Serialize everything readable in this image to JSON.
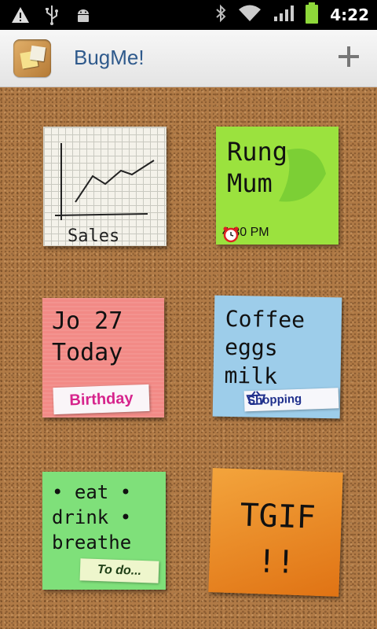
{
  "status_bar": {
    "time": "4:22",
    "icons": [
      "warning-icon",
      "usb-icon",
      "android-debug-icon",
      "bluetooth-icon",
      "wifi-icon",
      "signal-icon",
      "battery-icon"
    ]
  },
  "action_bar": {
    "title": "BugMe!",
    "add_icon": "plus-icon"
  },
  "notes": [
    {
      "color": "#f4f2ea",
      "text": "Sales",
      "kind": "graph"
    },
    {
      "color": "#9be23e",
      "text": "Rung Mum",
      "reminder_time": "4:30 PM"
    },
    {
      "color": "#f28a86",
      "text": "Jo 27 Today",
      "tag": "Birthday"
    },
    {
      "color": "#9dcdea",
      "text": "Coffee eggs milk",
      "tag": "Shopping"
    },
    {
      "color": "#7fe07a",
      "text": "• eat • drink • breathe",
      "tag": "To do..."
    },
    {
      "color": "#f08a22",
      "text": "TGIF !!"
    }
  ]
}
